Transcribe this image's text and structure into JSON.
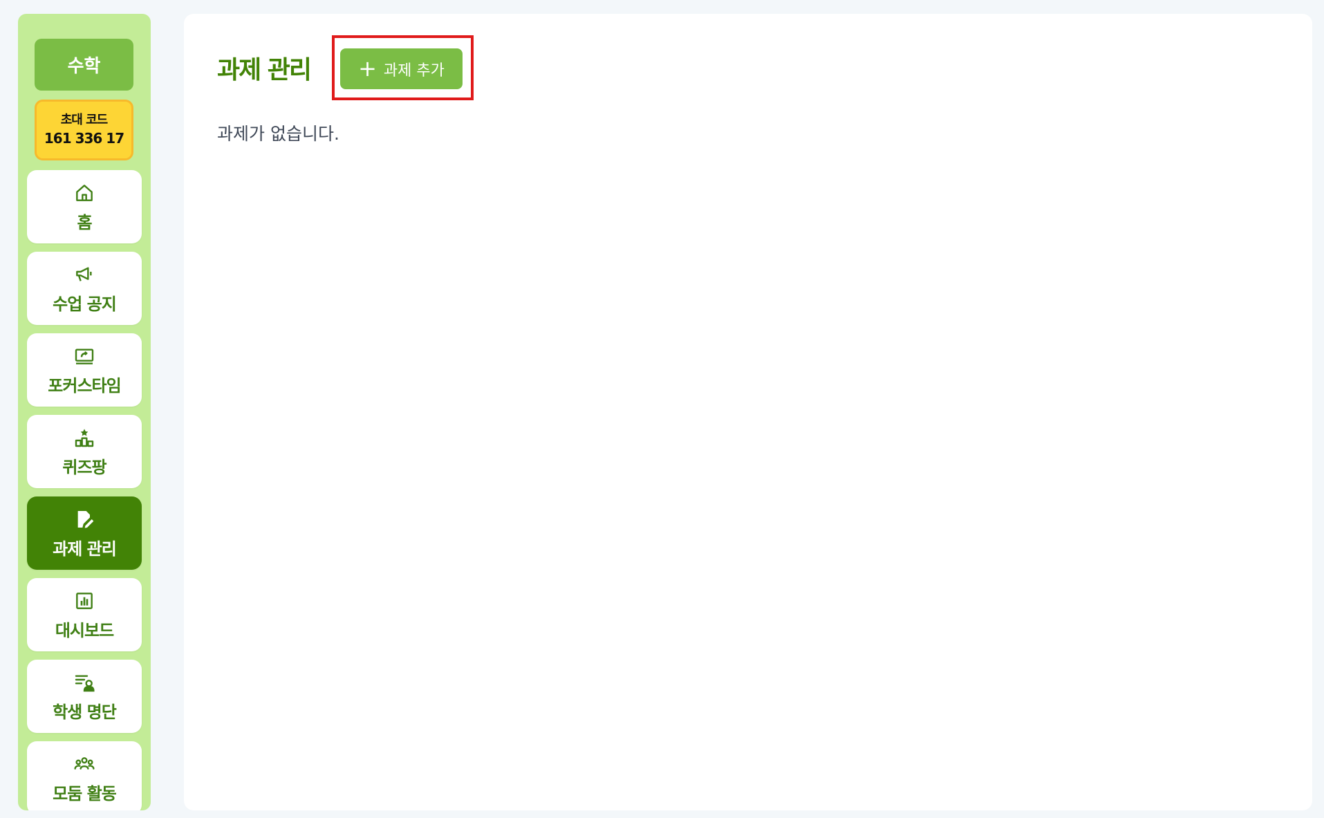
{
  "sidebar": {
    "class_name": "수학",
    "invite": {
      "label": "초대 코드",
      "code": "161 336 17"
    },
    "items": [
      {
        "label": "홈",
        "icon": "home-icon"
      },
      {
        "label": "수업 공지",
        "icon": "megaphone-icon"
      },
      {
        "label": "포커스타임",
        "icon": "screen-share-icon"
      },
      {
        "label": "퀴즈팡",
        "icon": "podium-star-icon"
      },
      {
        "label": "과제 관리",
        "icon": "pencil-file-icon",
        "active": true
      },
      {
        "label": "대시보드",
        "icon": "bar-chart-icon"
      },
      {
        "label": "학생 명단",
        "icon": "user-list-icon"
      },
      {
        "label": "모둠 활동",
        "icon": "group-icon"
      }
    ]
  },
  "main": {
    "title": "과제 관리",
    "add_button": "과제 추가",
    "empty_message": "과제가 없습니다."
  },
  "colors": {
    "sidebar_bg": "#c3ec97",
    "accent": "#7bbd45",
    "active": "#428306",
    "invite_bg": "#fdd535",
    "highlight": "#e01b1b"
  }
}
